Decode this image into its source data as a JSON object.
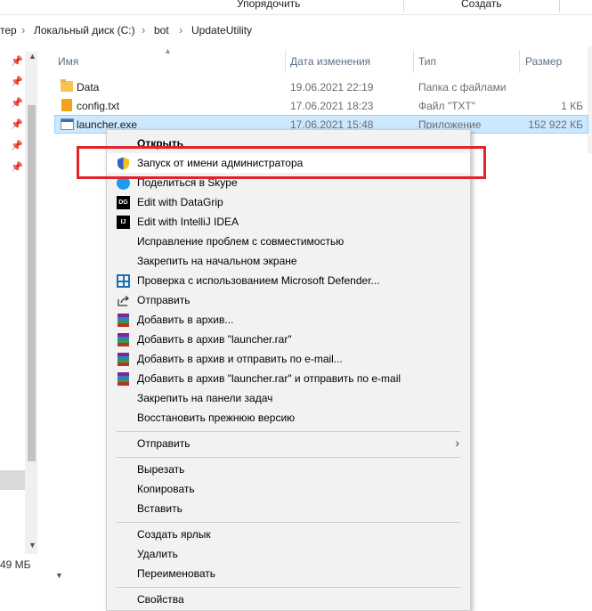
{
  "ribbon": {
    "labels": [
      "Упорядочить",
      "Создать"
    ]
  },
  "address": {
    "crumbs": [
      "тер",
      "Локальный диск (C:)",
      "bot",
      "UpdateUtility"
    ]
  },
  "status": {
    "size_text": "49 МБ"
  },
  "columns": {
    "name": "Имя",
    "date": "Дата изменения",
    "type": "Тип",
    "size": "Размер"
  },
  "files": [
    {
      "name": "Data",
      "date": "19.06.2021 22:19",
      "type": "Папка с файлами",
      "size": "",
      "icon": "folder-icon"
    },
    {
      "name": "config.txt",
      "date": "17.06.2021 18:23",
      "type": "Файл \"TXT\"",
      "size": "1 КБ",
      "icon": "text-file-icon"
    },
    {
      "name": "launcher.exe",
      "date": "17.06.2021 15:48",
      "type": "Приложение",
      "size": "152 922 КБ",
      "icon": "exe-icon"
    }
  ],
  "menu": {
    "open": "Открыть",
    "run_as_admin": "Запуск от имени администратора",
    "share_skype": "Поделиться в Skype",
    "datagrip": "Edit with DataGrip",
    "idea": "Edit with IntelliJ IDEA",
    "compat": "Исправление проблем с совместимостью",
    "pin_start": "Закрепить на начальном экране",
    "defender": "Проверка с использованием Microsoft Defender...",
    "send1": "Отправить",
    "add_archive": "Добавить в архив...",
    "add_rar": "Добавить в архив \"launcher.rar\"",
    "add_email": "Добавить в архив и отправить по e-mail...",
    "add_rar_email": "Добавить в архив \"launcher.rar\" и отправить по e-mail",
    "pin_taskbar": "Закрепить на панели задач",
    "restore": "Восстановить прежнюю версию",
    "send_to": "Отправить",
    "cut": "Вырезать",
    "copy": "Копировать",
    "paste": "Вставить",
    "shortcut": "Создать ярлык",
    "delete": "Удалить",
    "rename": "Переименовать",
    "properties": "Свойства"
  },
  "dg_icon_text": "DG",
  "ij_icon_text": "IJ",
  "colors": {
    "highlight": "#e1242b",
    "selection": "#cce8ff"
  }
}
